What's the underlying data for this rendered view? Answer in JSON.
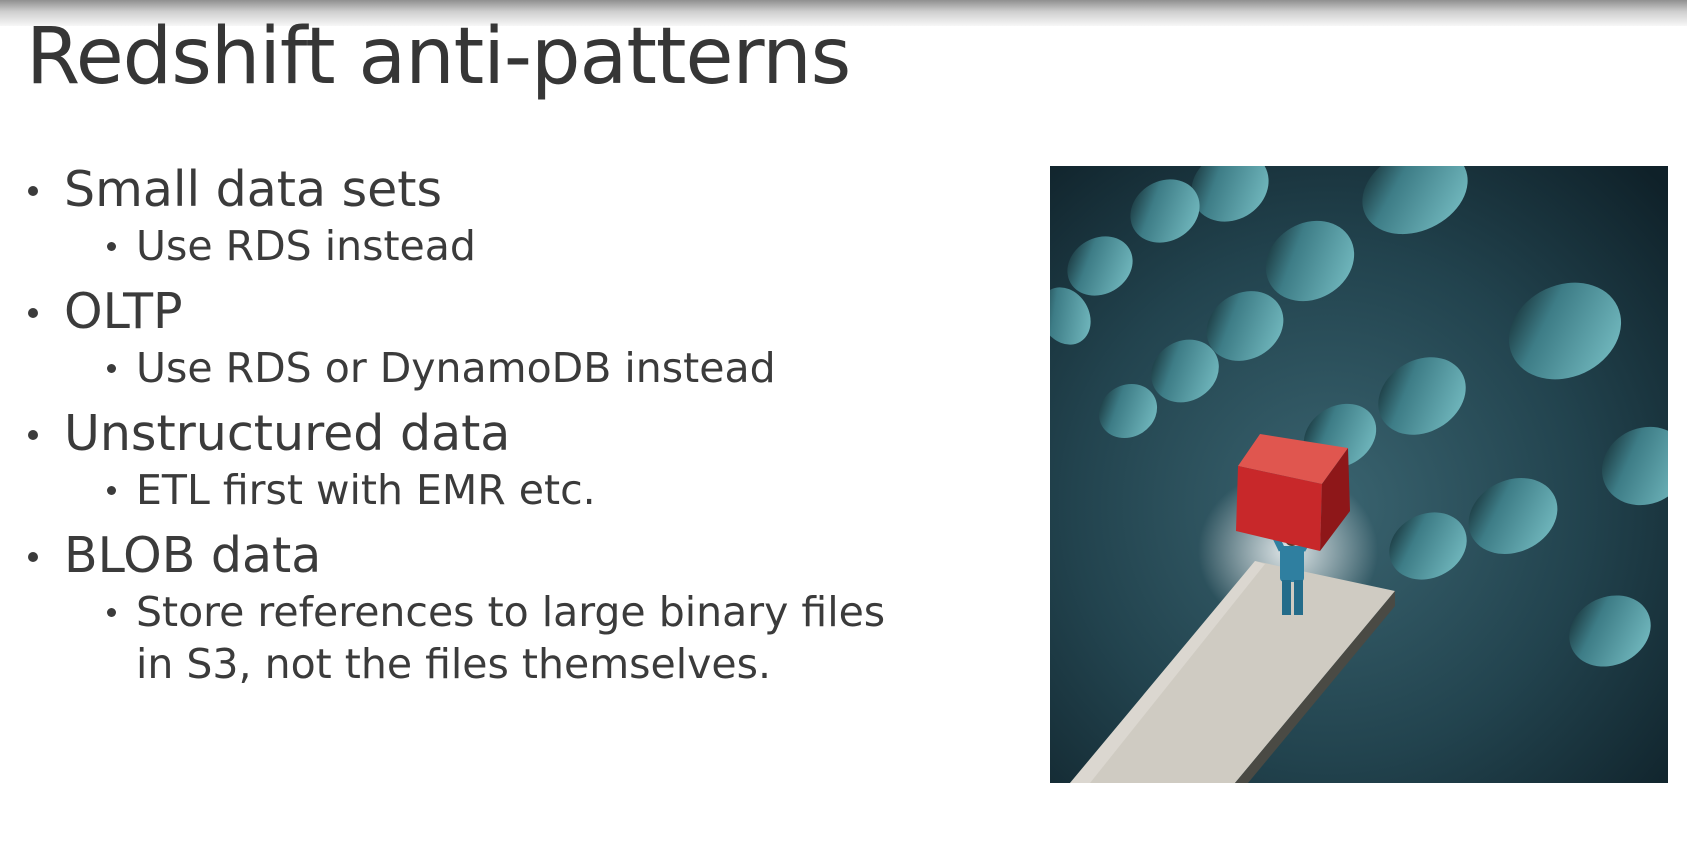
{
  "slide": {
    "title": "Redshift anti-patterns",
    "bullets": [
      {
        "text": "Small data sets",
        "subs": [
          "Use RDS instead"
        ]
      },
      {
        "text": "OLTP",
        "subs": [
          "Use RDS or DynamoDB instead"
        ]
      },
      {
        "text": "Unstructured data",
        "subs": [
          "ETL first with EMR etc."
        ]
      },
      {
        "text": "BLOB data",
        "subs": [
          "Store references to large binary files in S3, not the files themselves."
        ]
      }
    ]
  },
  "illustration": {
    "subject": "businessman lifting red cube on ledge facing wall of holes",
    "colors": {
      "wall": "#1f3f4a",
      "cube": "#c8282a",
      "ledge": "#cfcbc2"
    }
  }
}
